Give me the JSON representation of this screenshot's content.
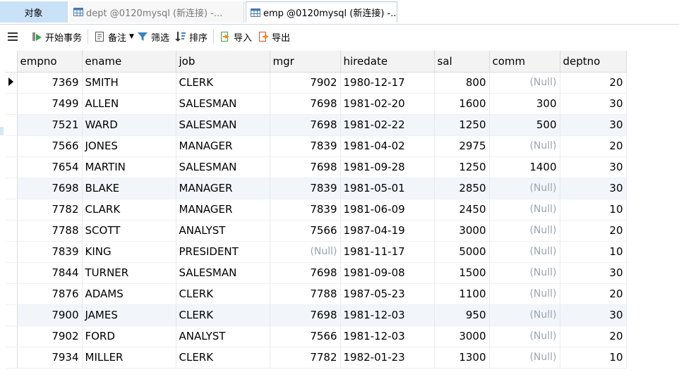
{
  "tabs": {
    "objects": "对象",
    "dept": "dept @0120mysql (新连接) -...",
    "emp": "emp @0120mysql (新连接) -..."
  },
  "toolbar": {
    "begin_transaction": "开始事务",
    "memo": "备注",
    "filter": "筛选",
    "sort": "排序",
    "import": "导入",
    "export": "导出"
  },
  "table": {
    "columns": [
      "empno",
      "ename",
      "job",
      "mgr",
      "hiredate",
      "sal",
      "comm",
      "deptno"
    ],
    "null_text": "(Null)",
    "rows": [
      {
        "empno": "7369",
        "ename": "SMITH",
        "job": "CLERK",
        "mgr": "7902",
        "hiredate": "1980-12-17",
        "sal": "800",
        "comm": "(Null)",
        "deptno": "20"
      },
      {
        "empno": "7499",
        "ename": "ALLEN",
        "job": "SALESMAN",
        "mgr": "7698",
        "hiredate": "1981-02-20",
        "sal": "1600",
        "comm": "300",
        "deptno": "30"
      },
      {
        "empno": "7521",
        "ename": "WARD",
        "job": "SALESMAN",
        "mgr": "7698",
        "hiredate": "1981-02-22",
        "sal": "1250",
        "comm": "500",
        "deptno": "30"
      },
      {
        "empno": "7566",
        "ename": "JONES",
        "job": "MANAGER",
        "mgr": "7839",
        "hiredate": "1981-04-02",
        "sal": "2975",
        "comm": "(Null)",
        "deptno": "20"
      },
      {
        "empno": "7654",
        "ename": "MARTIN",
        "job": "SALESMAN",
        "mgr": "7698",
        "hiredate": "1981-09-28",
        "sal": "1250",
        "comm": "1400",
        "deptno": "30"
      },
      {
        "empno": "7698",
        "ename": "BLAKE",
        "job": "MANAGER",
        "mgr": "7839",
        "hiredate": "1981-05-01",
        "sal": "2850",
        "comm": "(Null)",
        "deptno": "30"
      },
      {
        "empno": "7782",
        "ename": "CLARK",
        "job": "MANAGER",
        "mgr": "7839",
        "hiredate": "1981-06-09",
        "sal": "2450",
        "comm": "(Null)",
        "deptno": "10"
      },
      {
        "empno": "7788",
        "ename": "SCOTT",
        "job": "ANALYST",
        "mgr": "7566",
        "hiredate": "1987-04-19",
        "sal": "3000",
        "comm": "(Null)",
        "deptno": "20"
      },
      {
        "empno": "7839",
        "ename": "KING",
        "job": "PRESIDENT",
        "mgr": "(Null)",
        "hiredate": "1981-11-17",
        "sal": "5000",
        "comm": "(Null)",
        "deptno": "10"
      },
      {
        "empno": "7844",
        "ename": "TURNER",
        "job": "SALESMAN",
        "mgr": "7698",
        "hiredate": "1981-09-08",
        "sal": "1500",
        "comm": "(Null)",
        "deptno": "30"
      },
      {
        "empno": "7876",
        "ename": "ADAMS",
        "job": "CLERK",
        "mgr": "7788",
        "hiredate": "1987-05-23",
        "sal": "1100",
        "comm": "(Null)",
        "deptno": "20"
      },
      {
        "empno": "7900",
        "ename": "JAMES",
        "job": "CLERK",
        "mgr": "7698",
        "hiredate": "1981-12-03",
        "sal": "950",
        "comm": "(Null)",
        "deptno": "30"
      },
      {
        "empno": "7902",
        "ename": "FORD",
        "job": "ANALYST",
        "mgr": "7566",
        "hiredate": "1981-12-03",
        "sal": "3000",
        "comm": "(Null)",
        "deptno": "20"
      },
      {
        "empno": "7934",
        "ename": "MILLER",
        "job": "CLERK",
        "mgr": "7782",
        "hiredate": "1982-01-23",
        "sal": "1300",
        "comm": "(Null)",
        "deptno": "10"
      }
    ],
    "current_row": 0
  },
  "colors": {
    "objects_tab_bg": "#c9e2f8",
    "null_text": "#9aa5b1",
    "alt_row_bg": "#f2f6fb"
  },
  "icons": [
    "menu-icon",
    "transaction-icon",
    "memo-icon",
    "filter-icon",
    "sort-icon",
    "import-icon",
    "export-icon",
    "table-icon",
    "row-pointer-icon"
  ]
}
